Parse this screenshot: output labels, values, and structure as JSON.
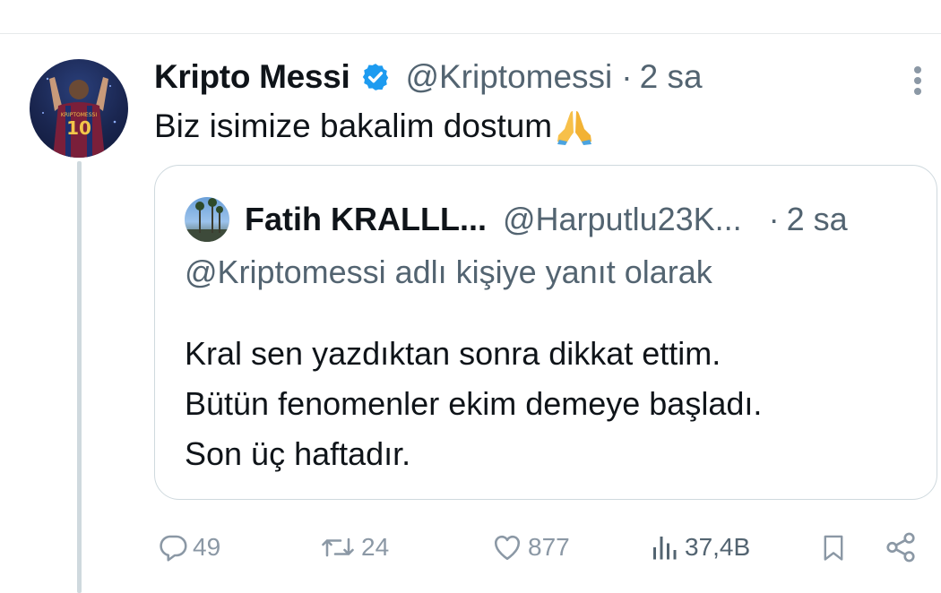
{
  "tweet": {
    "author_name": "Kripto Messi",
    "handle": "@Kriptomessi",
    "separator": "·",
    "time": "2 sa",
    "text": "Biz isimize bakalim dostum",
    "emoji": "🙏",
    "avatar_jersey_name": "KRIPTOMESSI",
    "avatar_jersey_number": "10"
  },
  "quoted": {
    "author_name": "Fatih KRALLL...",
    "handle": "@Harputlu23K...",
    "separator": "·",
    "time": "2 sa",
    "reply_context": "@Kriptomessi adlı kişiye yanıt olarak",
    "lines": [
      "Kral sen yazdıktan sonra dikkat ettim.",
      "Bütün fenomenler ekim demeye başladı.",
      "Son üç haftadır."
    ]
  },
  "actions": {
    "replies": "49",
    "reposts": "24",
    "likes": "877",
    "views": "37,4B"
  },
  "icons": {
    "verified": "verified-badge-icon",
    "more": "more-vertical-icon",
    "reply": "reply-icon",
    "repost": "repost-icon",
    "like": "heart-icon",
    "views": "views-bar-chart-icon",
    "bookmark": "bookmark-icon",
    "share": "share-icon"
  },
  "colors": {
    "verified_blue": "#1d9bf0",
    "secondary_text": "#536471",
    "action_gray": "#8b98a5",
    "border": "#cfd9de"
  }
}
